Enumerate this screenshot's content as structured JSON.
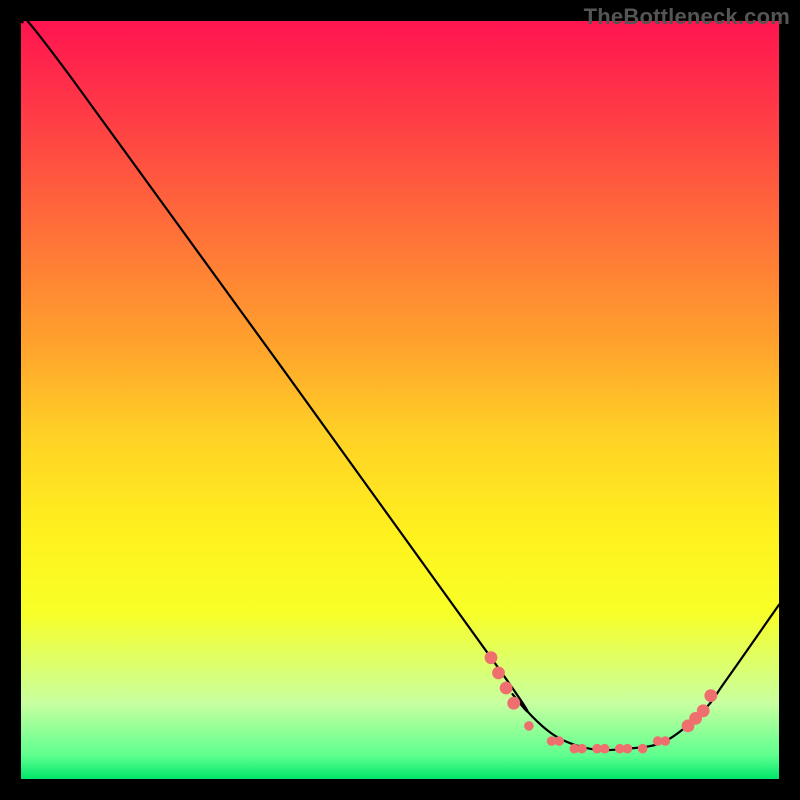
{
  "watermark": "TheBottleneck.com",
  "colors": {
    "frame": "#000000",
    "curve": "#000000",
    "marker": "#ef6f6f",
    "gradient_top": "#ff1450",
    "gradient_bottom": "#00e66a"
  },
  "chart_data": {
    "type": "line",
    "title": "",
    "xlabel": "",
    "ylabel": "",
    "xlim": [
      0,
      100
    ],
    "ylim": [
      0,
      100
    ],
    "grid": false,
    "legend": false,
    "curve": {
      "x": [
        0,
        7,
        62,
        65,
        70,
        75,
        80,
        85,
        90,
        93,
        100
      ],
      "y": [
        100,
        92,
        16,
        11,
        6,
        4,
        4,
        5,
        9,
        13,
        23
      ]
    },
    "markers": [
      {
        "x": 62,
        "y": 16,
        "r": 4
      },
      {
        "x": 63,
        "y": 14,
        "r": 4
      },
      {
        "x": 64,
        "y": 12,
        "r": 4
      },
      {
        "x": 65,
        "y": 10,
        "r": 4
      },
      {
        "x": 67,
        "y": 7,
        "r": 3
      },
      {
        "x": 70,
        "y": 5,
        "r": 3
      },
      {
        "x": 71,
        "y": 5,
        "r": 3
      },
      {
        "x": 73,
        "y": 4,
        "r": 3
      },
      {
        "x": 74,
        "y": 4,
        "r": 3
      },
      {
        "x": 76,
        "y": 4,
        "r": 3
      },
      {
        "x": 77,
        "y": 4,
        "r": 3
      },
      {
        "x": 79,
        "y": 4,
        "r": 3
      },
      {
        "x": 80,
        "y": 4,
        "r": 3
      },
      {
        "x": 82,
        "y": 4,
        "r": 3
      },
      {
        "x": 84,
        "y": 5,
        "r": 3
      },
      {
        "x": 85,
        "y": 5,
        "r": 3
      },
      {
        "x": 88,
        "y": 7,
        "r": 4
      },
      {
        "x": 89,
        "y": 8,
        "r": 4
      },
      {
        "x": 90,
        "y": 9,
        "r": 4
      },
      {
        "x": 91,
        "y": 11,
        "r": 4
      }
    ]
  }
}
